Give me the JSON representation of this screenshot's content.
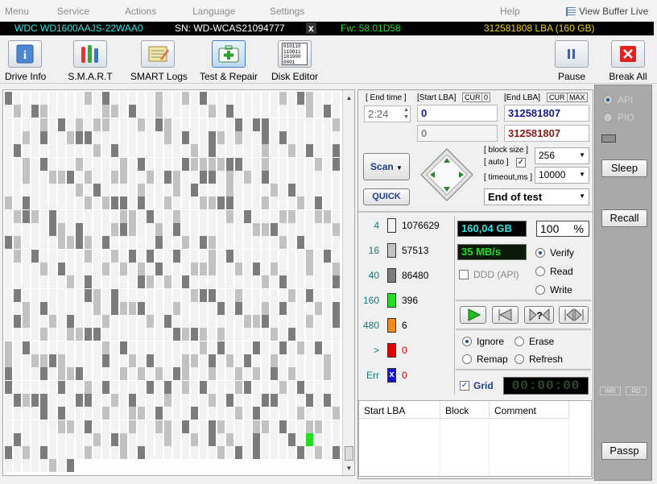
{
  "menu": {
    "items": [
      "Menu",
      "Service",
      "Actions",
      "Language",
      "Settings",
      "Help"
    ],
    "view_buffer": "View Buffer Live"
  },
  "infobar": {
    "model": "WDC WD1600AAJS-22WAA0",
    "serial": "SN: WD-WCAS21094777",
    "close": "x",
    "firmware": "Fw: 58.01D58",
    "capacity": "312581808 LBA (160 GB)"
  },
  "toolbar": {
    "drive_info": "Drive Info",
    "smart": "S.M.A.R.T",
    "smart_logs": "SMART Logs",
    "test_repair": "Test & Repair",
    "disk_editor": "Disk Editor",
    "pause": "Pause",
    "break_all": "Break All",
    "disk_editor_icon_text": "010110\n110011\n101000\n0001"
  },
  "controls": {
    "end_time_label": "[ End time ]",
    "end_time_value": "2:24",
    "start_lba_label": "[Start LBA]",
    "cur_label": "CUR",
    "zero_label": "0",
    "end_lba_label": "[End LBA]",
    "max_label": "MAX",
    "start_lba_value": "0",
    "end_lba_value": "312581807",
    "start_lba_value2": "0",
    "end_lba_value2": "312581807",
    "scan_label": "Scan",
    "quick_label": "QUICK",
    "block_size_label": "[ block size ]",
    "auto_label": "[ auto ]",
    "block_size_value": "256",
    "timeout_label": "[ timeout,ms ]",
    "timeout_value": "10000",
    "end_action": "End of test"
  },
  "legend": [
    {
      "threshold": "4",
      "count": "1076629",
      "color": "#f2f2f2"
    },
    {
      "threshold": "16",
      "count": "57513",
      "color": "#c2c2c2"
    },
    {
      "threshold": "40",
      "count": "86480",
      "color": "#7c7c7c"
    },
    {
      "threshold": "160",
      "count": "396",
      "color": "#22dd22"
    },
    {
      "threshold": "480",
      "count": "6",
      "color": "#f08a1c"
    },
    {
      "threshold": ">",
      "count": "0",
      "color": "#e00000"
    },
    {
      "threshold": "Err",
      "count": "0",
      "color": "#1414c8",
      "mark": "x"
    }
  ],
  "status": {
    "scanned": "160,04 GB",
    "percent": "100",
    "percent_unit": "%",
    "speed": "35 MB/s",
    "ddd_api": "DDD (API)"
  },
  "modes": {
    "verify": "Verify",
    "read": "Read",
    "write": "Write",
    "selected": "verify"
  },
  "repair": {
    "ignore": "Ignore",
    "erase": "Erase",
    "remap": "Remap",
    "refresh": "Refresh",
    "selected": "ignore"
  },
  "grid_label": "Grid",
  "timer": "00:00:00",
  "table": {
    "headers": [
      "Start LBA",
      "Block",
      "Comment"
    ]
  },
  "side": {
    "api": "API",
    "pio": "PIO",
    "sleep": "Sleep",
    "recall": "Recall",
    "wr": "WR",
    "rd": "RD",
    "passp": "Passp"
  },
  "colors": {
    "lba_blue": "#1a1a8c",
    "lba_red": "#8b1a1a",
    "cyan": "#2fe3e3",
    "lime": "#22dd22",
    "yellow": "#f0d11a"
  }
}
